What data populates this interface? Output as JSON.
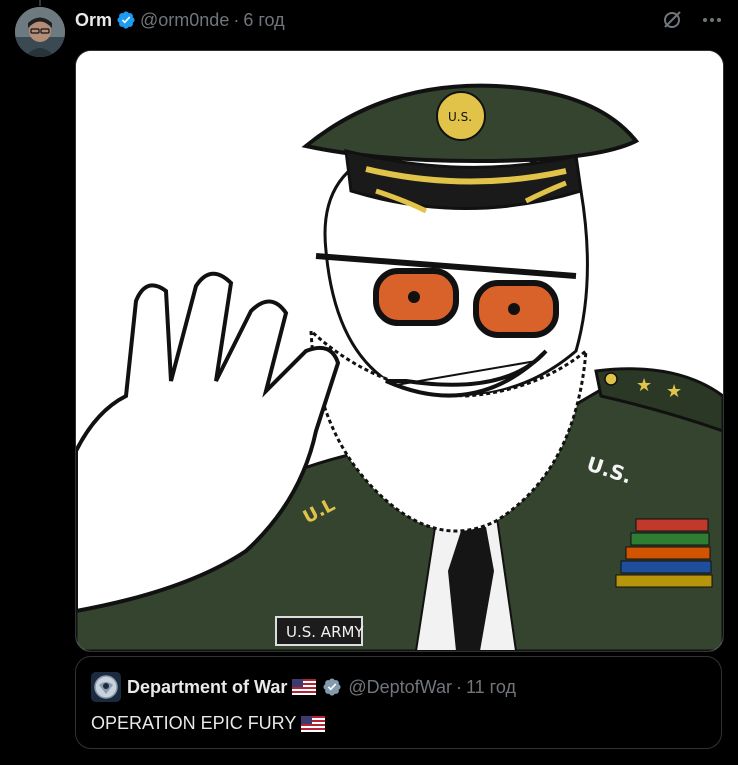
{
  "post": {
    "author_name": "Orm",
    "handle": "@orm0nde",
    "time": "6 год",
    "media_label": "U.S. ARMY",
    "sleeve_left": "U.L",
    "collar_right": "U.S.",
    "cap_badge": "U.S."
  },
  "quote": {
    "author_name": "Department of War",
    "handle": "@DeptofWar",
    "time": "11 год",
    "text": "OPERATION EPIC FURY"
  },
  "colors": {
    "background": "#000000",
    "text": "#e7e9ea",
    "muted": "#71767b",
    "verified_blue": "#1d9bf0",
    "verified_gray": "#829aab",
    "border": "#2f3336"
  },
  "icons": [
    "verified-badge-icon",
    "grok-icon",
    "more-icon",
    "us-flag-icon"
  ]
}
